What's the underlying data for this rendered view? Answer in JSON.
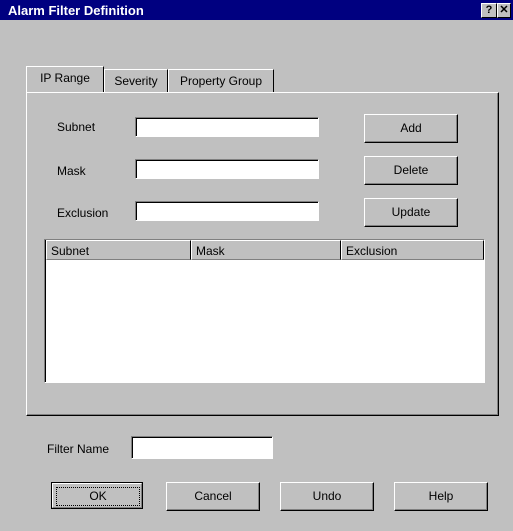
{
  "window": {
    "title": "Alarm Filter Definition",
    "help_glyph": "?",
    "close_glyph": "✕"
  },
  "tabs": [
    {
      "label": "IP Range",
      "active": true
    },
    {
      "label": "Severity",
      "active": false
    },
    {
      "label": "Property Group",
      "active": false
    }
  ],
  "ip_range": {
    "subnet_label": "Subnet",
    "subnet_value": "",
    "mask_label": "Mask",
    "mask_value": "",
    "exclusion_label": "Exclusion",
    "exclusion_value": "",
    "add_label": "Add",
    "delete_label": "Delete",
    "update_label": "Update",
    "table": {
      "columns": [
        "Subnet",
        "Mask",
        "Exclusion"
      ],
      "rows": []
    }
  },
  "filter_name": {
    "label": "Filter Name",
    "value": ""
  },
  "footer": {
    "ok_label": "OK",
    "cancel_label": "Cancel",
    "undo_label": "Undo",
    "help_label": "Help"
  }
}
